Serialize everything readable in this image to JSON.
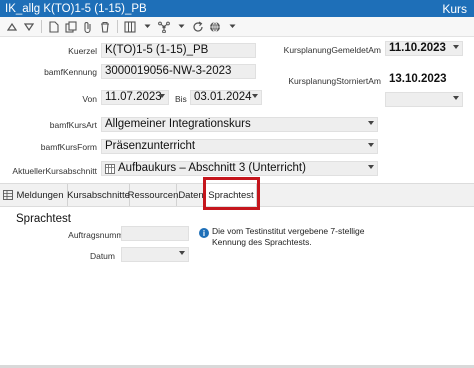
{
  "window": {
    "title": "IK_allg K(TO)1-5 (1-15)_PB",
    "module": "Kurs"
  },
  "toolbar": {
    "icons": [
      "triangle-up-icon",
      "triangle-down-icon",
      "document-icon",
      "copy-icon",
      "paperclip-icon",
      "delete-icon",
      "columns-icon",
      "link-icon",
      "refresh-icon",
      "globe-icon"
    ]
  },
  "form": {
    "kuerzel": {
      "label": "Kuerzel",
      "value": "K(TO)1-5 (1-15)_PB"
    },
    "bamfKennung": {
      "label": "bamfKennung",
      "value": "3000019056-NW-3-2023"
    },
    "von": {
      "label": "Von",
      "value": "11.07.2023"
    },
    "bis": {
      "label": "Bis",
      "value": "03.01.2024"
    },
    "bamfKursArt": {
      "label": "bamfKursArt",
      "value": "Allgemeiner Integrationskurs"
    },
    "bamfKursForm": {
      "label": "bamfKursForm",
      "value": "Präsenzunterricht"
    },
    "aktuellerKursabschnitt": {
      "label": "AktuellerKursabschnitt",
      "value": "Aufbaukurs – Abschnitt 3 (Unterricht)"
    },
    "kursplanungGemeldetAm": {
      "label": "KursplanungGemeldetAm",
      "value": "11.10.2023"
    },
    "kursplanungStorniertAm": {
      "label": "KursplanungStorniertAm",
      "value": "13.10.2023"
    }
  },
  "tabs": [
    "Meldungen",
    "Kursabschnitte",
    "Ressourcen",
    "Daten",
    "Sprachtest"
  ],
  "active_tab": "Sprachtest",
  "sprachtest": {
    "title": "Sprachtest",
    "auftragsnummer": {
      "label": "Auftragsnummer",
      "value": ""
    },
    "datum": {
      "label": "Datum",
      "value": ""
    },
    "info": "Die vom Testinstitut vergebene 7-stellige Kennung des Sprachtests."
  },
  "colors": {
    "titlebar": "#1e6fb8",
    "highlight": "#c5161d",
    "field_bg": "#eeeeee"
  }
}
